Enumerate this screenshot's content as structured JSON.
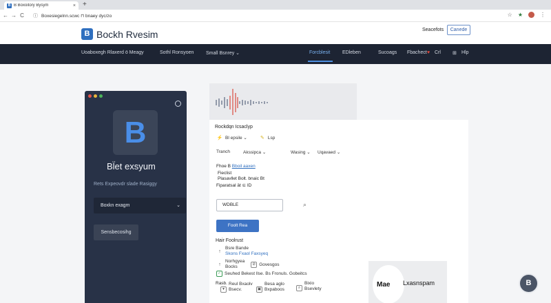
{
  "browser": {
    "tab_title": "B Boxoitory Bysym",
    "new_tab": "+",
    "close": "×",
    "url": "Boxesiegelnn.scwc ⊓ bnaey dyc/zo",
    "icons": {
      "back": "←",
      "forward": "→",
      "reload": "C",
      "info": "ⓘ",
      "bookmark": "☆",
      "extensions": "★",
      "menu": "⋮"
    }
  },
  "header": {
    "logo_letter": "B",
    "logo_text": "Bockh Rvesim",
    "signin": "Seacefots",
    "console": "Canede"
  },
  "nav": {
    "items": [
      {
        "label": "Uoaboxegh Rlaxerd ö Meagy",
        "active": false
      },
      {
        "label": "Sothl Ronsyoen",
        "active": false
      },
      {
        "label": "Small Bsnrey  ⌄",
        "active": false
      },
      {
        "label": "Forcblesit",
        "active": true
      },
      {
        "label": "EDleben",
        "active": false
      },
      {
        "label": "Sucoags",
        "active": false
      },
      {
        "label": "Fbachect",
        "active": false
      },
      {
        "label": "♥",
        "active": false
      },
      {
        "label": "Crl",
        "active": false
      },
      {
        "label": "Hlp",
        "active": false
      }
    ],
    "help_icon": "⊞"
  },
  "panel": {
    "dots": [
      "#e2534a",
      "#e8b33b",
      "#4bb35a"
    ],
    "settings_icon": "⚙",
    "logo_letter": "B",
    "title": "Bl̈et exsyum",
    "subtitle": "Rets Expeovdr slade Rasiggy",
    "select_label": "Boxkn exagm",
    "select_icon": "⌄",
    "button_label": "Sensbecosihg"
  },
  "content": {
    "heading": "Rockdqn Icsaclyp",
    "row1": {
      "icon1": "⚡",
      "label": "Bl epsile  ⌄",
      "icon2": "✎",
      "label2": "Lsp"
    },
    "row2": {
      "label1": "Tranch",
      "label2": "Akssipca  ⌄",
      "label3": "Wasing  ⌄",
      "label4": "Uqavaed  ⌄"
    },
    "link_line": {
      "prefix": "Fhoe B ",
      "link": "Bboil aaxen"
    },
    "info_line1": "Fieclist",
    "info_line2": "Plasavllet Bolt. bnaic Bt",
    "info_line3": "Fiparatsal ät ⊆ ID",
    "search_value": "WDBLE",
    "search_icon": "⌕",
    "button_label": "Foolt Rea",
    "section_label": "Hair Foolrust",
    "list": [
      {
        "icon": "↑",
        "title": "Bsre Bande",
        "subtitle": "Skons Fxaol Faxsyeq"
      },
      {
        "icon": "↑",
        "title": "Norhgyea",
        "subtitle": "Bocks",
        "tag": "Govesgos"
      },
      {
        "icon": "✓",
        "title": "Seuhed Bekest llse. Bs Fronuls. Gobeitcs",
        "subtitle": ""
      }
    ],
    "footer_items": [
      {
        "title": "Reul Bxaolv",
        "subtitle": "Bsecv."
      },
      {
        "title": "Besa aglo",
        "subtitle": "Bxpaboos"
      },
      {
        "title": "Bixio",
        "subtitle": "Bsevlety"
      }
    ],
    "footer_label": "Rasb."
  },
  "thumb": {
    "left_text": "Mae",
    "right_text": "Lxasnspam"
  },
  "fab_letter": "B"
}
